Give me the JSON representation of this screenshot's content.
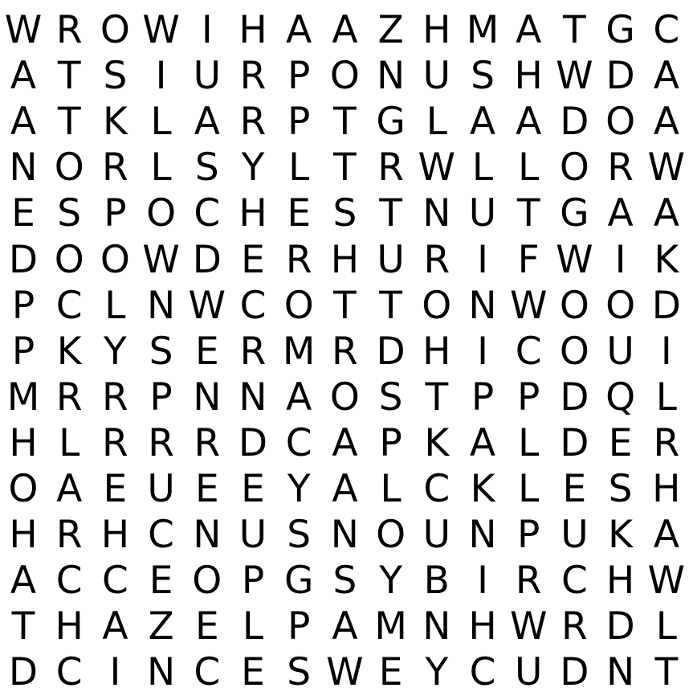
{
  "puzzle": {
    "rows": [
      "WROWIHAAZHMATGC",
      "ATSIURPONUSHWDA",
      "ATKLARPTGLAADOA",
      "NORLSYLTRWLLORW",
      "ESPOCHESTNUTGAA",
      "DOOWDERHURIFWIK",
      "PCLNWCOTTONWOOD",
      "PKYSERMRDHICOUI",
      "MRRPNNAOSTPPDQL",
      "HLRRRDCAPKALDER",
      "OAEUEEYALCKLESH",
      "HRHCNUSNOUNPUKA",
      "ACCEOPGSYBIRCHW",
      "THAZELPAMNHWRDL",
      "DCINCESWEYCUDNT"
    ],
    "text_color": "#000000",
    "background_color": "#ffffff"
  }
}
